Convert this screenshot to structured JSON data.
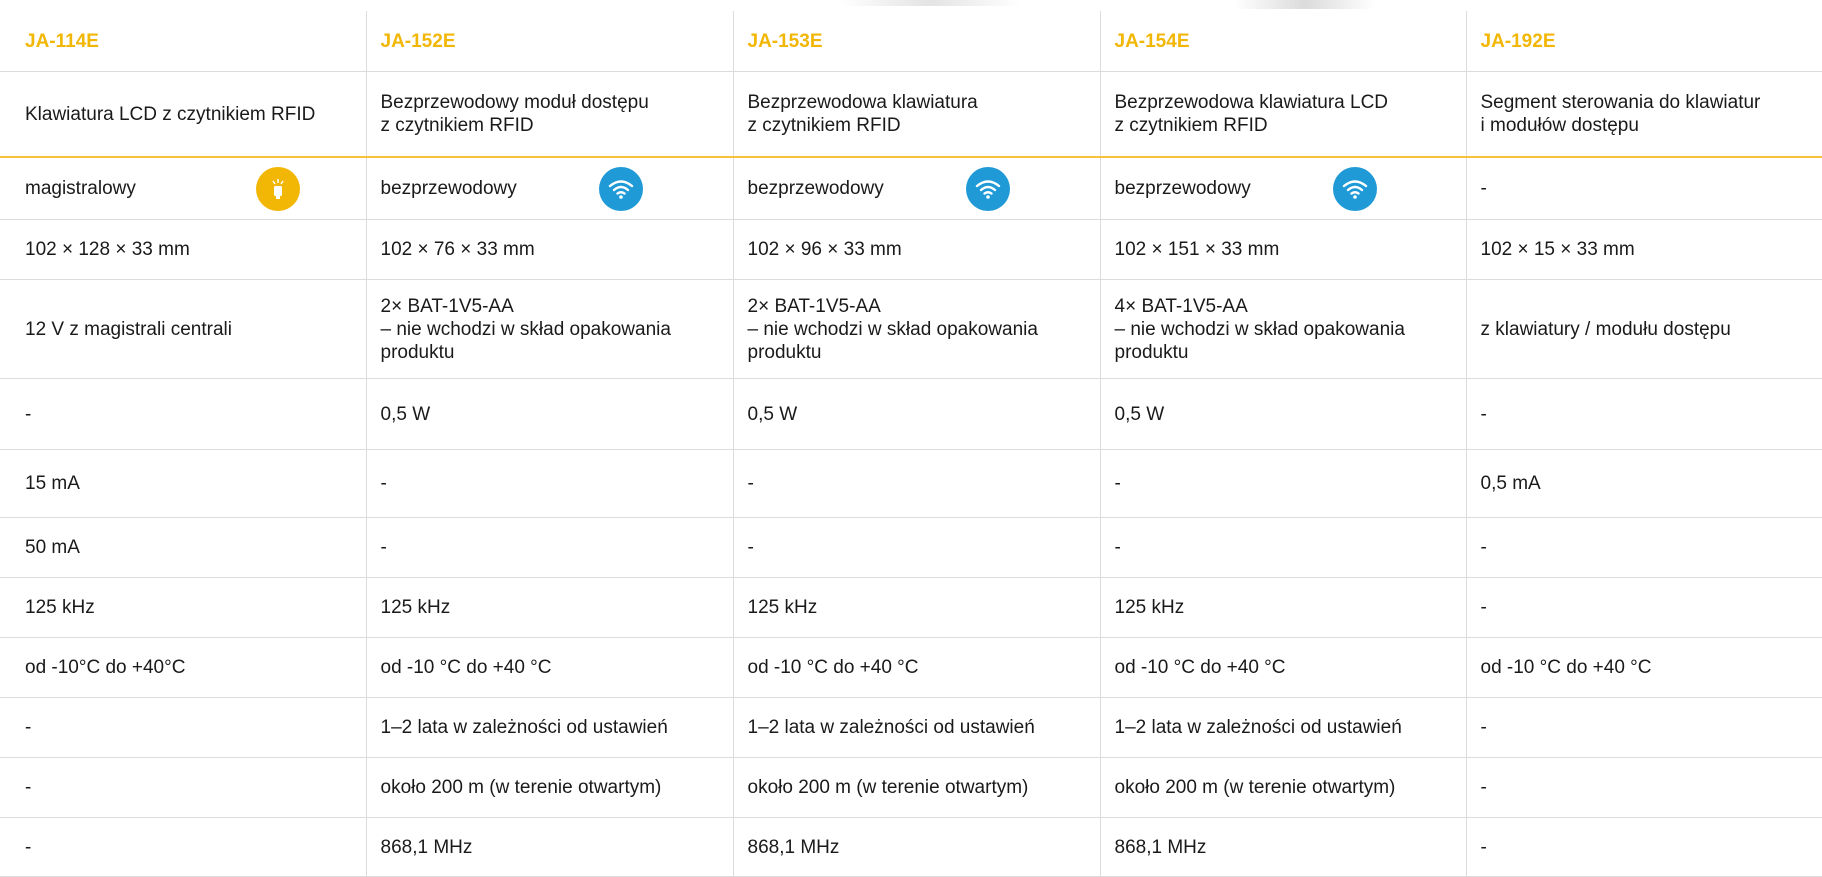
{
  "colors": {
    "accent": "#f2b705",
    "wireless_icon": "#1f9ad6",
    "grid": "#dcdcdc"
  },
  "products": [
    {
      "code": "JA-114E",
      "description": "Klawiatura LCD z czytnikiem RFID",
      "communication": "magistralowy",
      "communication_icon": "bus-icon",
      "dimensions": "102 × 128 × 33 mm",
      "power": "12 V z magistrali centrali",
      "power_w": "-",
      "current_standby": "15 mA",
      "current_max": "50 mA",
      "rfid": "125 kHz",
      "temperature": "od -10°C do +40°C",
      "battery_life": "-",
      "range": "-",
      "frequency": "-"
    },
    {
      "code": "JA-152E",
      "description": "Bezprzewodowy moduł dostępu\nz czytnikiem RFID",
      "communication": "bezprzewodowy",
      "communication_icon": "wireless-icon",
      "dimensions": "102 × 76 × 33 mm",
      "power": "2× BAT-1V5-AA\n– nie wchodzi w skład opakowania\nproduktu",
      "power_w": "0,5 W",
      "current_standby": "-",
      "current_max": "-",
      "rfid": "125 kHz",
      "temperature": "od -10 °C do +40 °C",
      "battery_life": "1–2 lata w zależności od ustawień",
      "range": "około 200 m (w terenie otwartym)",
      "frequency": "868,1 MHz"
    },
    {
      "code": "JA-153E",
      "description": "Bezprzewodowa klawiatura\nz czytnikiem RFID",
      "communication": "bezprzewodowy",
      "communication_icon": "wireless-icon",
      "dimensions": "102 × 96 × 33 mm",
      "power": "2× BAT-1V5-AA\n– nie wchodzi w skład opakowania\nproduktu",
      "power_w": "0,5 W",
      "current_standby": "-",
      "current_max": "-",
      "rfid": "125 kHz",
      "temperature": "od -10 °C do +40 °C",
      "battery_life": "1–2 lata w zależności od ustawień",
      "range": "około 200 m (w terenie otwartym)",
      "frequency": "868,1 MHz"
    },
    {
      "code": "JA-154E",
      "description": "Bezprzewodowa klawiatura LCD\nz czytnikiem RFID",
      "communication": "bezprzewodowy",
      "communication_icon": "wireless-icon",
      "dimensions": "102 × 151 × 33 mm",
      "power": "4× BAT-1V5-AA\n– nie wchodzi w skład opakowania\nproduktu",
      "power_w": "0,5 W",
      "current_standby": "-",
      "current_max": "-",
      "rfid": "125 kHz",
      "temperature": "od -10 °C do +40 °C",
      "battery_life": "1–2 lata w zależności od ustawień",
      "range": "około 200 m (w terenie otwartym)",
      "frequency": "868,1 MHz"
    },
    {
      "code": "JA-192E",
      "description": "Segment sterowania do klawiatur\ni modułów dostępu",
      "communication": "-",
      "communication_icon": "",
      "dimensions": "102 × 15 × 33 mm",
      "power": "z klawiatury / modułu dostępu",
      "power_w": "-",
      "current_standby": "0,5 mA",
      "current_max": "-",
      "rfid": "-",
      "temperature": "od -10 °C do +40 °C",
      "battery_life": "-",
      "range": "-",
      "frequency": "-"
    }
  ]
}
